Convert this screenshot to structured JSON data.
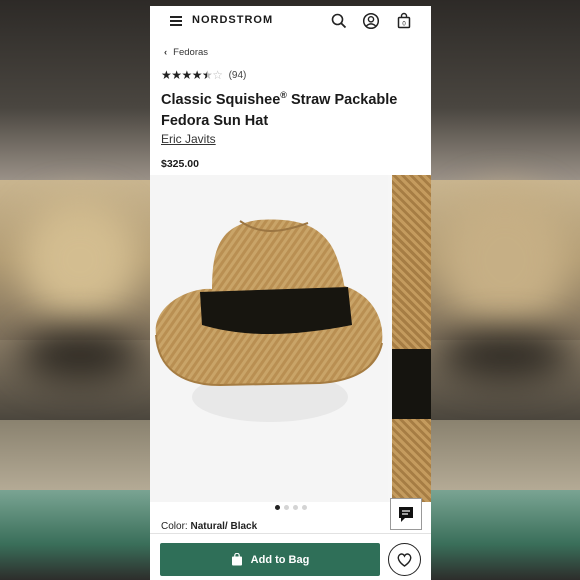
{
  "header": {
    "brand": "NORDSTROM",
    "icons": [
      "menu-icon",
      "search-icon",
      "account-icon",
      "bag-icon"
    ]
  },
  "breadcrumb": {
    "label": "Fedoras"
  },
  "product": {
    "rating_value": 4.5,
    "rating_max": 5,
    "review_count": "(94)",
    "title_part1": "Classic Squishee",
    "title_reg": "®",
    "title_part2": " Straw Packable Fedora Sun Hat",
    "brand_name": "Eric Javits",
    "price": "$325.00",
    "color_label": "Color:",
    "color_value": "Natural/ Black"
  },
  "gallery": {
    "image_count": 4,
    "active_index": 0
  },
  "actions": {
    "add_to_bag": "Add to Bag",
    "accent_color": "#2f6f58"
  }
}
